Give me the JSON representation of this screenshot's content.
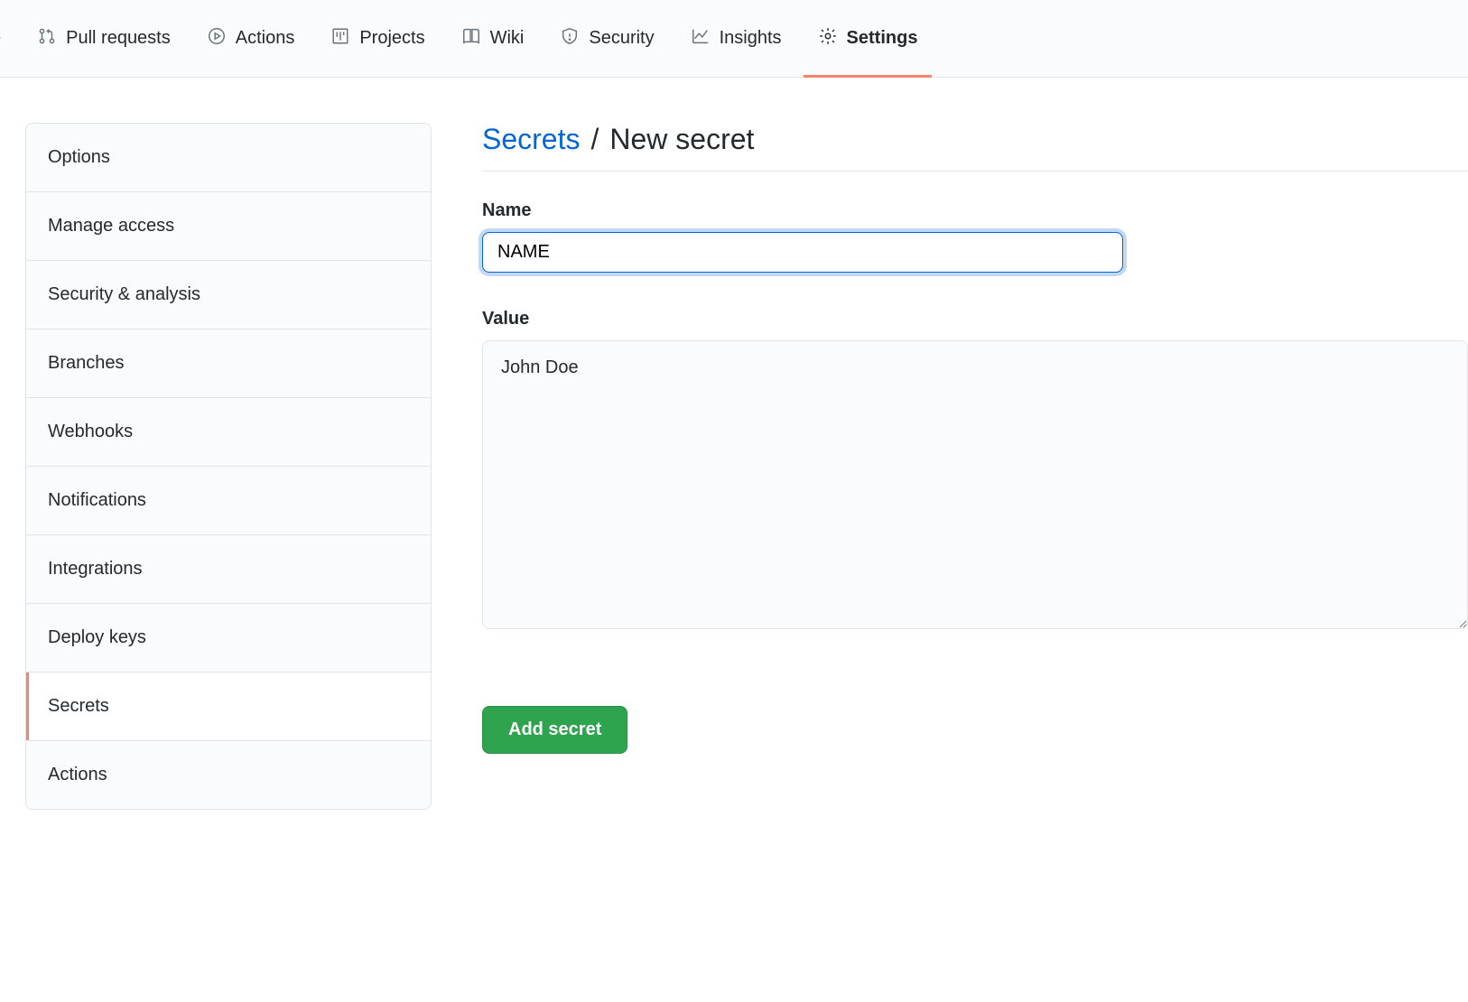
{
  "nav": {
    "partial_first": "e",
    "items": [
      {
        "label": "Pull requests",
        "icon": "git-pull-request-icon"
      },
      {
        "label": "Actions",
        "icon": "play-icon"
      },
      {
        "label": "Projects",
        "icon": "project-icon"
      },
      {
        "label": "Wiki",
        "icon": "book-icon"
      },
      {
        "label": "Security",
        "icon": "shield-icon"
      },
      {
        "label": "Insights",
        "icon": "graph-icon"
      },
      {
        "label": "Settings",
        "icon": "gear-icon",
        "active": true
      }
    ]
  },
  "sidebar": {
    "items": [
      {
        "label": "Options"
      },
      {
        "label": "Manage access"
      },
      {
        "label": "Security & analysis"
      },
      {
        "label": "Branches"
      },
      {
        "label": "Webhooks"
      },
      {
        "label": "Notifications"
      },
      {
        "label": "Integrations"
      },
      {
        "label": "Deploy keys"
      },
      {
        "label": "Secrets",
        "active": true
      },
      {
        "label": "Actions"
      }
    ]
  },
  "breadcrumb": {
    "parent": "Secrets",
    "separator": "/",
    "current": "New secret"
  },
  "form": {
    "name_label": "Name",
    "name_value": "NAME",
    "value_label": "Value",
    "value_text": "John Doe",
    "submit_label": "Add secret"
  }
}
